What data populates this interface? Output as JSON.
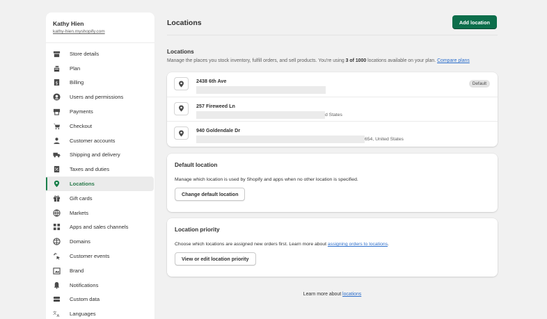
{
  "store": {
    "name": "Kathy Hien",
    "url": "kathy-hien.myshopify.com"
  },
  "sidebar": {
    "items": [
      {
        "label": "Store details",
        "icon": "store-icon"
      },
      {
        "label": "Plan",
        "icon": "plan-icon"
      },
      {
        "label": "Billing",
        "icon": "billing-icon"
      },
      {
        "label": "Users and permissions",
        "icon": "user-icon"
      },
      {
        "label": "Payments",
        "icon": "payments-icon"
      },
      {
        "label": "Checkout",
        "icon": "cart-icon"
      },
      {
        "label": "Customer accounts",
        "icon": "person-icon"
      },
      {
        "label": "Shipping and delivery",
        "icon": "truck-icon"
      },
      {
        "label": "Taxes and duties",
        "icon": "tax-icon"
      },
      {
        "label": "Locations",
        "icon": "location-pin-icon",
        "active": true
      },
      {
        "label": "Gift cards",
        "icon": "gift-icon"
      },
      {
        "label": "Markets",
        "icon": "globe-icon"
      },
      {
        "label": "Apps and sales channels",
        "icon": "apps-icon"
      },
      {
        "label": "Domains",
        "icon": "domain-globe-icon"
      },
      {
        "label": "Customer events",
        "icon": "cursor-icon"
      },
      {
        "label": "Brand",
        "icon": "brand-icon"
      },
      {
        "label": "Notifications",
        "icon": "bell-icon"
      },
      {
        "label": "Custom data",
        "icon": "database-icon"
      },
      {
        "label": "Languages",
        "icon": "translate-icon"
      }
    ]
  },
  "header": {
    "title": "Locations",
    "add_button": "Add location"
  },
  "locations_section": {
    "title": "Locations",
    "desc_before": "Manage the places you stock inventory, fulfill orders, and sell products. You're using ",
    "desc_bold": "3 of 1000",
    "desc_after": " locations available on your plan. ",
    "compare_link": "Compare plans"
  },
  "locations": [
    {
      "name": "2438 6th Ave",
      "addr_tail": "",
      "badge": "Default"
    },
    {
      "name": "257 Fireweed Ln",
      "addr_tail": "d States",
      "badge": ""
    },
    {
      "name": "940 Goldendale Dr",
      "addr_tail": "654, United States",
      "badge": ""
    }
  ],
  "default_location": {
    "title": "Default location",
    "text": "Manage which location is used by Shopify and apps when no other location is specified.",
    "button": "Change default location"
  },
  "location_priority": {
    "title": "Location priority",
    "text_before": "Choose which locations are assigned new orders first. Learn more about ",
    "link": "assigning orders to locations",
    "text_after": ".",
    "button": "View or edit location priority"
  },
  "footer": {
    "text_before": "Learn more about ",
    "link": "locations"
  },
  "colors": {
    "accent": "#0c6e4b",
    "active_text": "#2a7a4b",
    "link": "#2c6ecb",
    "background": "#f1f1f1"
  }
}
